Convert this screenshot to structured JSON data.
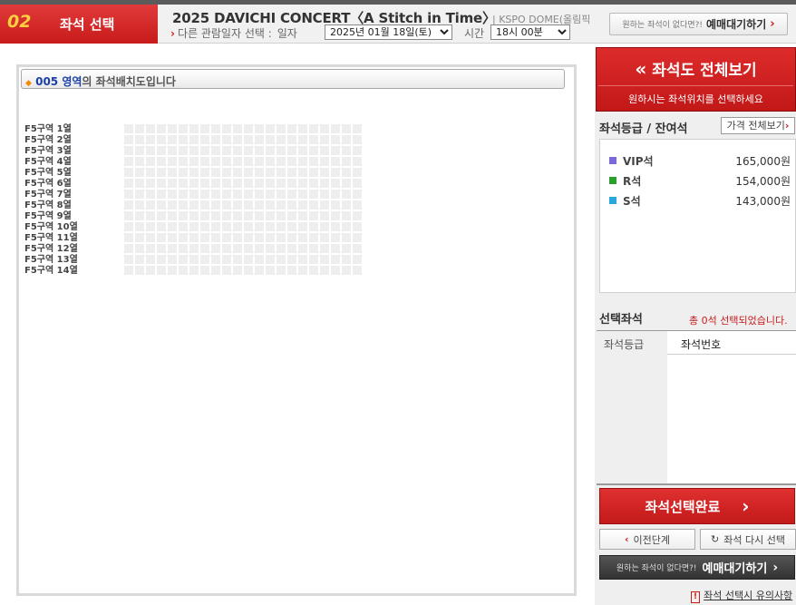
{
  "header": {
    "step_number": "02",
    "step_label": "좌석 선택",
    "concert_title": "2025 DAVICHI CONCERT〈A Stitch in Time〉",
    "venue": "| KSPO DOME(올림픽",
    "other_date_label": "다른 관람일자 선택 :",
    "date_label": "일자",
    "date_value": "2025년 01월 18일(토)",
    "time_label": "시간",
    "time_value": "18시 00분",
    "wait_small": "원하는 좌석이 없다면?!",
    "wait_big": "예매대기하기"
  },
  "seatmap": {
    "zone_number": "005 영역",
    "zone_suffix": "의 좌석배치도입니다",
    "rows": [
      "F5구역 1열",
      "F5구역 2열",
      "F5구역 3열",
      "F5구역 4열",
      "F5구역 5열",
      "F5구역 6열",
      "F5구역 7열",
      "F5구역 8열",
      "F5구역 9열",
      "F5구역 10열",
      "F5구역 11열",
      "F5구역 12열",
      "F5구역 13열",
      "F5구역 14열"
    ]
  },
  "sidebar": {
    "view_all": "좌석도 전체보기",
    "view_all_sub": "원하시는 좌석위치를 선택하세요",
    "grade_title": "좌석등급 / 잔여석",
    "price_button": "가격 전체보기",
    "grades": [
      {
        "name": "VIP석",
        "price": "165,000원",
        "color": "#7b68d9"
      },
      {
        "name": "R석",
        "price": "154,000원",
        "color": "#2ca02c"
      },
      {
        "name": "S석",
        "price": "143,000원",
        "color": "#29a8e0"
      }
    ],
    "selected_title": "선택좌석",
    "selected_count": "총 0석 선택되었습니다.",
    "col_grade": "좌석등급",
    "col_seat": "좌석번호",
    "complete_button": "좌석선택완료",
    "prev_button": "이전단계",
    "reset_button": "좌석 다시 선택",
    "wait_small": "원하는 좌석이 없다면?!",
    "wait_big": "예매대기하기",
    "notice": "좌석 선택시 유의사항"
  }
}
